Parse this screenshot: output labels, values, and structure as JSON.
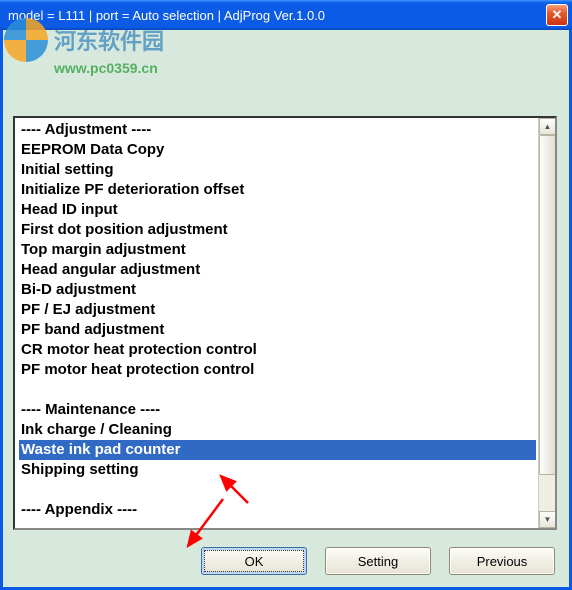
{
  "titlebar": {
    "text": "model = L111 | port = Auto selection | AdjProg Ver.1.0.0"
  },
  "watermark": {
    "siteName": "河东软件园",
    "url": "www.pc0359.cn"
  },
  "list": {
    "items": [
      {
        "label": "---- Adjustment ----",
        "selected": false
      },
      {
        "label": "EEPROM Data Copy",
        "selected": false
      },
      {
        "label": "Initial setting",
        "selected": false
      },
      {
        "label": "Initialize PF deterioration offset",
        "selected": false
      },
      {
        "label": "Head ID input",
        "selected": false
      },
      {
        "label": "First dot position adjustment",
        "selected": false
      },
      {
        "label": "Top margin adjustment",
        "selected": false
      },
      {
        "label": "Head angular adjustment",
        "selected": false
      },
      {
        "label": "Bi-D adjustment",
        "selected": false
      },
      {
        "label": "PF / EJ adjustment",
        "selected": false
      },
      {
        "label": "PF band adjustment",
        "selected": false
      },
      {
        "label": "CR motor heat protection control",
        "selected": false
      },
      {
        "label": "PF motor heat protection control",
        "selected": false
      },
      {
        "label": "",
        "selected": false
      },
      {
        "label": "---- Maintenance ----",
        "selected": false
      },
      {
        "label": "Ink charge / Cleaning",
        "selected": false
      },
      {
        "label": "Waste ink pad counter",
        "selected": true
      },
      {
        "label": "Shipping setting",
        "selected": false
      },
      {
        "label": "",
        "selected": false
      },
      {
        "label": "---- Appendix ----",
        "selected": false
      }
    ]
  },
  "buttons": {
    "ok": "OK",
    "setting": "Setting",
    "previous": "Previous"
  }
}
